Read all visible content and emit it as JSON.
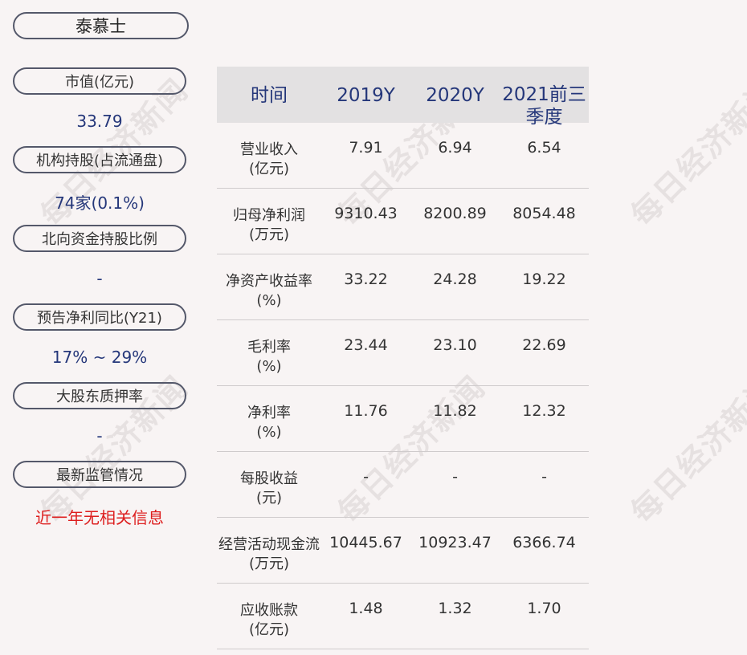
{
  "company": "泰慕士",
  "sidebar": [
    {
      "label": "市值(亿元)",
      "value": "33.79"
    },
    {
      "label": "机构持股(占流通盘)",
      "value": "74家(0.1%)"
    },
    {
      "label": "北向资金持股比例",
      "value": "-"
    },
    {
      "label": "预告净利同比(Y21)",
      "value": "17% ~ 29%"
    },
    {
      "label": "大股东质押率",
      "value": "-"
    },
    {
      "label": "最新监管情况",
      "value": "近一年无相关信息"
    }
  ],
  "table": {
    "headers": [
      "时间",
      "2019Y",
      "2020Y",
      "2021前三季度"
    ],
    "rows": [
      {
        "label": "营业收入",
        "unit": "(亿元)",
        "values": [
          "7.91",
          "6.94",
          "6.54"
        ]
      },
      {
        "label": "归母净利润",
        "unit": "(万元)",
        "values": [
          "9310.43",
          "8200.89",
          "8054.48"
        ]
      },
      {
        "label": "净资产收益率",
        "unit": "(%)",
        "values": [
          "33.22",
          "24.28",
          "19.22"
        ]
      },
      {
        "label": "毛利率",
        "unit": "(%)",
        "values": [
          "23.44",
          "23.10",
          "22.69"
        ]
      },
      {
        "label": "净利率",
        "unit": "(%)",
        "values": [
          "11.76",
          "11.82",
          "12.32"
        ]
      },
      {
        "label": "每股收益",
        "unit": "(元)",
        "values": [
          "-",
          "-",
          "-"
        ]
      },
      {
        "label": "经营活动现金流",
        "unit": "(万元)",
        "values": [
          "10445.67",
          "10923.47",
          "6366.74"
        ]
      },
      {
        "label": "应收账款",
        "unit": "(亿元)",
        "values": [
          "1.48",
          "1.32",
          "1.70"
        ]
      }
    ]
  },
  "watermark": "每日经济新闻",
  "colors": {
    "accent": "#25377a",
    "alert": "#dd1e1e",
    "header_bg": "#e3e1e2"
  }
}
